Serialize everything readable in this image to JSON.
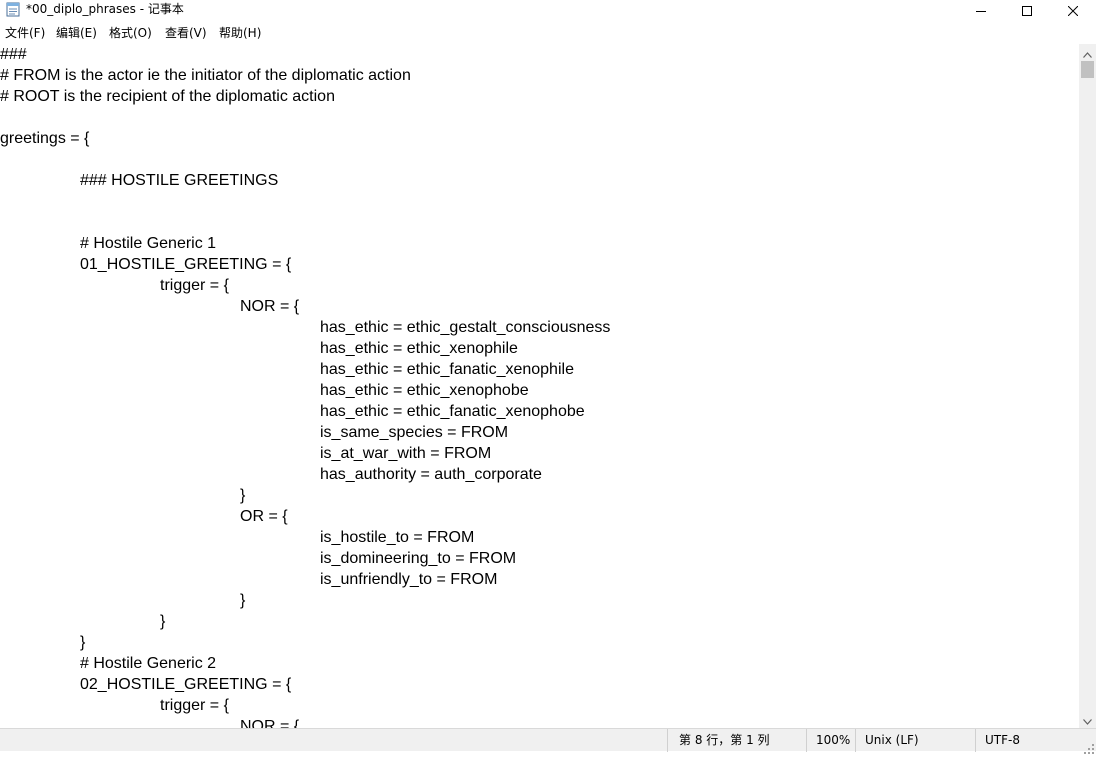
{
  "window": {
    "title": "*00_diplo_phrases - 记事本",
    "app_icon": "notepad-icon",
    "controls": [
      "minimize-icon",
      "maximize-icon",
      "close-icon"
    ]
  },
  "menu": {
    "items": [
      "文件(F)",
      "编辑(E)",
      "格式(O)",
      "查看(V)",
      "帮助(H)"
    ]
  },
  "editor": {
    "lines": [
      "###",
      "# FROM is the actor ie the initiator of the diplomatic action",
      "# ROOT is the recipient of the diplomatic action",
      "",
      "greetings = {",
      "",
      "\t### HOSTILE GREETINGS",
      "",
      "",
      "\t# Hostile Generic 1",
      "\t01_HOSTILE_GREETING = {",
      "\t\ttrigger = {",
      "\t\t\tNOR = {",
      "\t\t\t\thas_ethic = ethic_gestalt_consciousness",
      "\t\t\t\thas_ethic = ethic_xenophile",
      "\t\t\t\thas_ethic = ethic_fanatic_xenophile",
      "\t\t\t\thas_ethic = ethic_xenophobe",
      "\t\t\t\thas_ethic = ethic_fanatic_xenophobe",
      "\t\t\t\tis_same_species = FROM",
      "\t\t\t\tis_at_war_with = FROM",
      "\t\t\t\thas_authority = auth_corporate",
      "\t\t\t}",
      "\t\t\tOR = {",
      "\t\t\t\tis_hostile_to = FROM",
      "\t\t\t\tis_domineering_to = FROM",
      "\t\t\t\tis_unfriendly_to = FROM",
      "\t\t\t}",
      "\t\t}",
      "\t}",
      "\t# Hostile Generic 2",
      "\t02_HOSTILE_GREETING = {",
      "\t\ttrigger = {",
      "\t\t\tNOR = {"
    ]
  },
  "statusbar": {
    "position": "第 8 行，第 1 列",
    "zoom": "100%",
    "line_ending": "Unix (LF)",
    "encoding": "UTF-8"
  },
  "scrollbar": {
    "up_icon": "scroll-up-arrow-icon",
    "down_icon": "scroll-down-arrow-icon"
  }
}
